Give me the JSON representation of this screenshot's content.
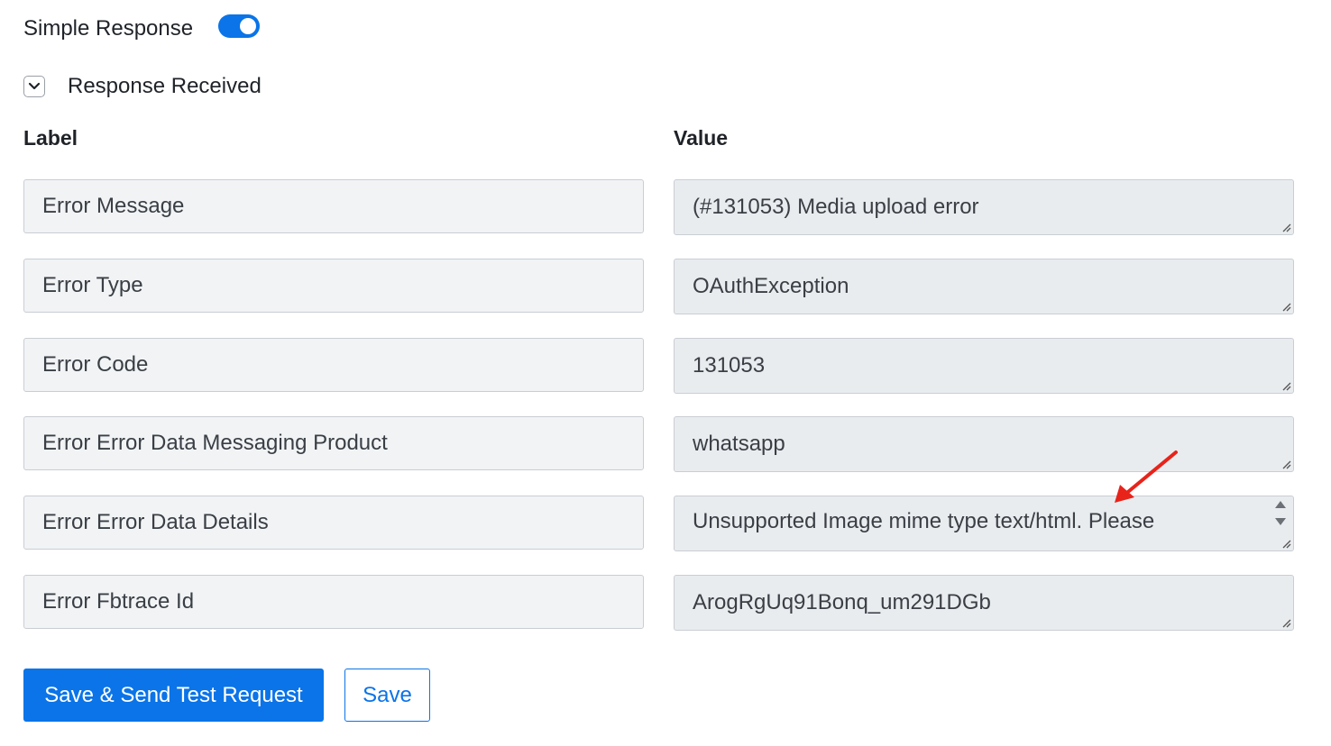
{
  "toggle": {
    "label": "Simple Response",
    "on": true,
    "accent": "#0a74e8"
  },
  "section": {
    "title": "Response Received",
    "icon": "chevron-down-icon",
    "expanded": true
  },
  "columns": {
    "label": "Label",
    "value": "Value"
  },
  "rows": [
    {
      "label": "Error Message",
      "value": "(#131053) Media upload error"
    },
    {
      "label": "Error Type",
      "value": "OAuthException"
    },
    {
      "label": "Error Code",
      "value": "131053"
    },
    {
      "label": "Error Error Data Messaging Product",
      "value": "whatsapp"
    },
    {
      "label": "Error Error Data Details",
      "value": "Unsupported Image mime type text/html. Please"
    },
    {
      "label": "Error Fbtrace Id",
      "value": "ArogRgUq91Bonq_um291DGb"
    }
  ],
  "buttons": {
    "primary": "Save & Send Test Request",
    "secondary": "Save"
  },
  "annotation": {
    "icon": "red-arrow-icon",
    "color": "#e8231a"
  }
}
